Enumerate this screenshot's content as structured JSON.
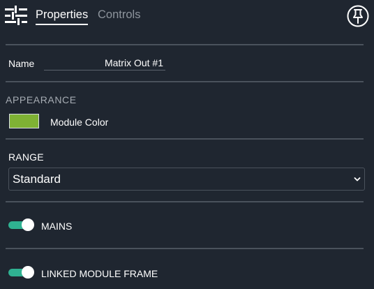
{
  "header": {
    "tabs": [
      {
        "label": "Properties",
        "active": true
      },
      {
        "label": "Controls",
        "active": false
      }
    ],
    "settings_icon": "sliders-icon",
    "pin_icon": "pin-icon"
  },
  "name_field": {
    "label": "Name",
    "value": "Matrix Out #1"
  },
  "appearance": {
    "heading": "APPEARANCE",
    "module_color_label": "Module Color",
    "module_color": "#7fb234"
  },
  "range": {
    "heading": "RANGE",
    "selected": "Standard"
  },
  "toggles": [
    {
      "label": "MAINS",
      "on": true
    },
    {
      "label": "LINKED MODULE FRAME",
      "on": true
    }
  ],
  "colors": {
    "background": "#1f2630",
    "divider": "#4a525c",
    "toggle_on": "#2fb191",
    "inactive_tab": "#8d949c"
  }
}
